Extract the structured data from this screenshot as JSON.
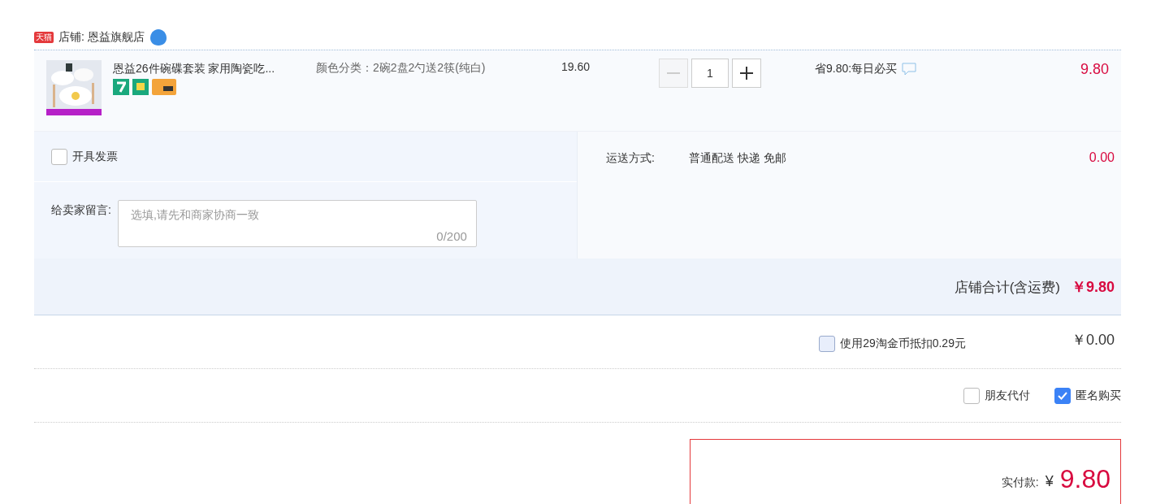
{
  "store": {
    "badge": "天猫",
    "label": "店铺: 恩益旗舰店"
  },
  "item": {
    "title": "恩益26件碗碟套装 家用陶瓷吃...",
    "sku": "颜色分类：2碗2盘2勺送2筷(纯白)",
    "price": "19.60",
    "quantity": "1",
    "minus_disabled": true,
    "promo": "省9.80:每日必买",
    "subtotal": "9.80"
  },
  "invoice": {
    "label": "开具发票",
    "checked": false
  },
  "message": {
    "label": "给卖家留言:",
    "placeholder": "选填,请先和商家协商一致",
    "counter": "0/200"
  },
  "shipping": {
    "label": "运送方式:",
    "method": "普通配送 快递 免邮",
    "fee": "0.00"
  },
  "store_total": {
    "label": "店铺合计(含运费)",
    "amount": "￥9.80"
  },
  "coins": {
    "label": "使用29淘金币抵扣0.29元",
    "checked": false,
    "amount": "￥0.00"
  },
  "options": [
    {
      "label": "朋友代付",
      "checked": false
    },
    {
      "label": "匿名购买",
      "checked": true
    }
  ],
  "payment": {
    "label": "实付款:",
    "currency": "¥",
    "amount": "9.80"
  }
}
